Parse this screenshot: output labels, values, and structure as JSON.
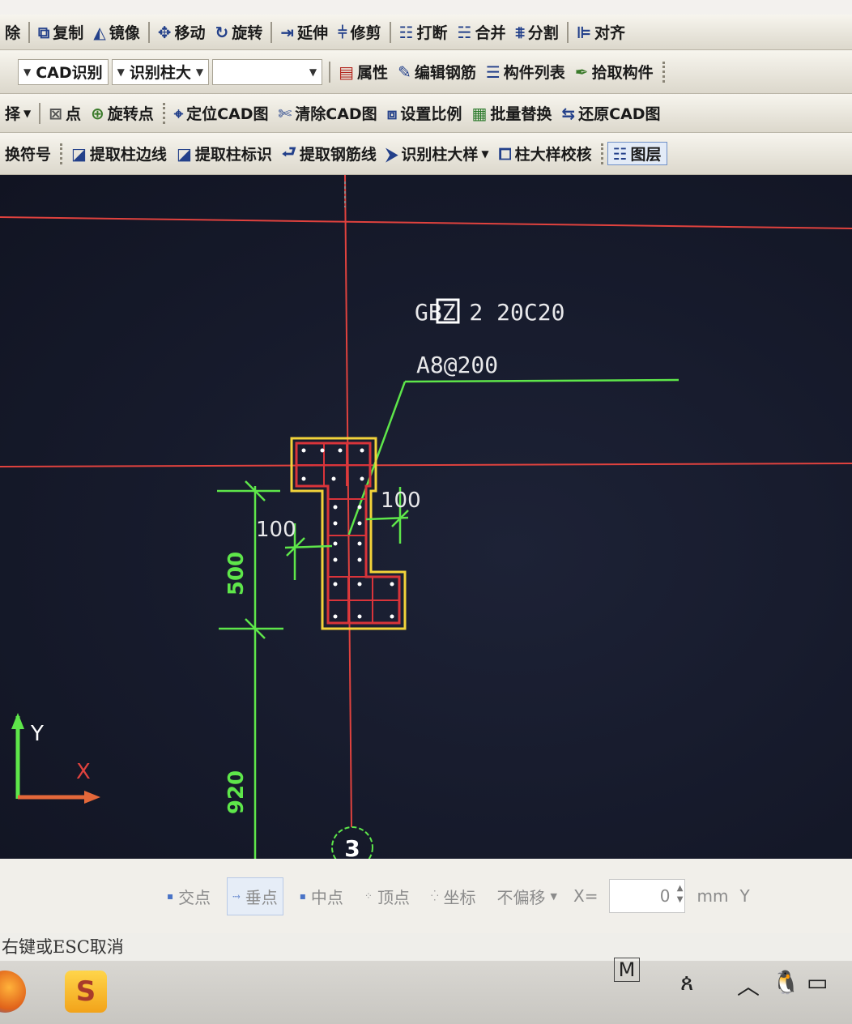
{
  "toolbar_row1": {
    "items": [
      "除",
      "复制",
      "镜像",
      "移动",
      "旋转",
      "延伸",
      "修剪",
      "打断",
      "合并",
      "分割",
      "对齐"
    ]
  },
  "toolbar_row2": {
    "combo1": "CAD识别",
    "combo2": "识别柱大",
    "items": [
      "属性",
      "编辑钢筋",
      "构件列表",
      "拾取构件"
    ]
  },
  "toolbar_row3": {
    "select_label": "择",
    "items": [
      "点",
      "旋转点",
      "定位CAD图",
      "清除CAD图",
      "设置比例",
      "批量替换",
      "还原CAD图"
    ]
  },
  "toolbar_row4": {
    "items": [
      "换符号",
      "提取柱边线",
      "提取柱标识",
      "提取钢筋线",
      "识别柱大样",
      "柱大样校核",
      "图层"
    ]
  },
  "drawing": {
    "label_column": "GBZ 2  20C20",
    "label_stirrup": "A8@200",
    "dim_100_left": "100",
    "dim_100_right": "100",
    "dim_500": "500",
    "dim_920": "920",
    "axis_bubble": "3",
    "ucs_x": "X",
    "ucs_y": "Y"
  },
  "snapbar": {
    "items": [
      "交点",
      "垂点",
      "中点",
      "顶点",
      "坐标"
    ],
    "offset_mode": "不偏移",
    "x_label": "X=",
    "x_value": "0",
    "unit": "mm",
    "y_label": "Y"
  },
  "status": {
    "message": "右键或ESC取消"
  },
  "taskbar": {
    "ime": "M"
  },
  "colors": {
    "canvas_bg": "#161a2b",
    "axis_red": "#e0423e",
    "dim_green": "#5ee64a",
    "column_yellow": "#f2d33a",
    "column_red": "#d9343a",
    "text_white": "#e8e8ea"
  }
}
